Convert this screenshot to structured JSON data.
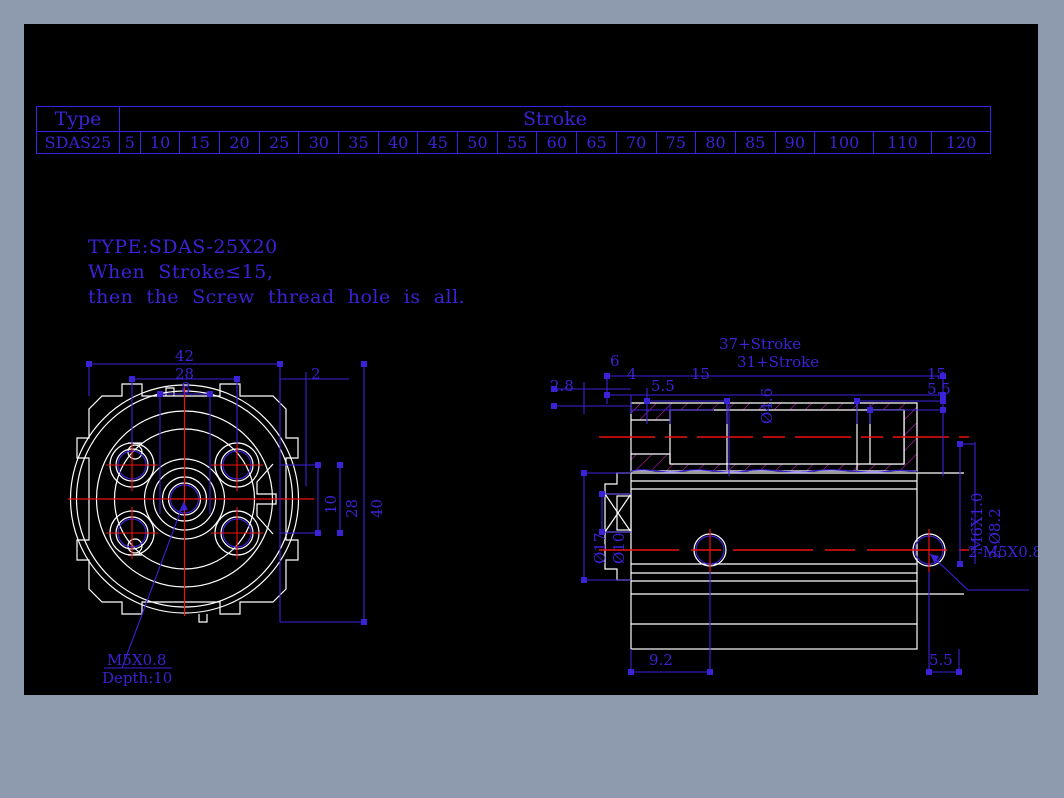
{
  "page": {
    "background_color": "#8e9aae",
    "canvas_color": "#000000",
    "line_color_white": "#ffffff",
    "line_color_blue": "#3a22d6",
    "line_color_red": "#ee1111",
    "hatch_color": "#cc22cc"
  },
  "table": {
    "type_header": "Type",
    "stroke_header": "Stroke",
    "type_value": "SDAS25",
    "strokes": [
      "5",
      "10",
      "15",
      "20",
      "25",
      "30",
      "35",
      "40",
      "45",
      "50",
      "55",
      "60",
      "65",
      "70",
      "75",
      "80",
      "85",
      "90",
      "100",
      "110",
      "120"
    ]
  },
  "notes": {
    "line1": "TYPE:SDAS-25X20",
    "line2": "When  Stroke≤15,",
    "line3": "then  the  Screw  thread  hole  is  all."
  },
  "front_view": {
    "dim_42": "42",
    "dim_28_top": "28",
    "dim_8": "8",
    "dim_2": "2",
    "dim_10": "10",
    "dim_28_right": "28",
    "dim_40": "40",
    "callout_thread": "M5X0.8",
    "callout_depth": "Depth:10"
  },
  "section_view": {
    "dim_37_stroke": "37+Stroke",
    "dim_31_stroke": "31+Stroke",
    "dim_2_8": "2.8",
    "dim_6": "6",
    "dim_4": "4",
    "dim_5_5_left": "5.5",
    "dim_15_left": "15",
    "dim_phi_4_6": "Ø4.6",
    "dim_15_right": "15",
    "dim_5_5_right": "5.5",
    "dim_phi_17": "Ø17",
    "dim_phi_10": "Ø10",
    "dim_m6x1": "M6X1.0",
    "dim_2_phi_8_2": "2-Ø8.2",
    "callout_2_m5": "2-M5X0.8",
    "dim_9_2": "9.2",
    "dim_5_5_bottom": "5.5"
  }
}
